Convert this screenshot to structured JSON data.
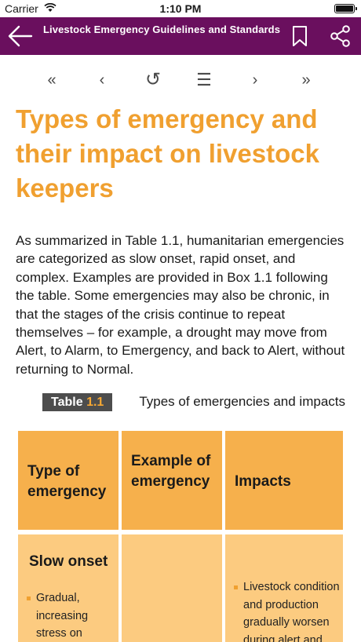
{
  "status_bar": {
    "carrier": "Carrier",
    "time": "1:10 PM"
  },
  "header": {
    "title": "Livestock Emergency Guidelines and Standards",
    "background": "#6a0f5e"
  },
  "icons": {
    "back": "arrow-left-icon",
    "bookmark": "bookmark-icon",
    "share": "share-icon"
  },
  "nav": {
    "first": "«",
    "prev": "‹",
    "reload": "↺",
    "menu": "☰",
    "next": "›",
    "last": "»"
  },
  "content": {
    "heading": "Types of emergency and their impact on livestock keepers",
    "intro": "As summarized in Table 1.1, humanitarian emergencies are categorized as slow onset, rapid onset, and complex. Examples are provided in Box 1.1 following the table. Some emergencies may also be chronic, in that the stages of the crisis continue to repeat themselves – for example, a drought may move from Alert, to Alarm, to Emergency, and back to Alert, without returning to Normal.",
    "table_caption": {
      "label": "Table",
      "number": "1.1",
      "title": "Types of emergencies and impacts"
    }
  },
  "table": {
    "headers": [
      "Type of emergency",
      "Example of emergency",
      "Impacts"
    ],
    "rows": [
      {
        "type": "Slow onset",
        "type_bullets": [
          "Gradual, increasing stress on"
        ],
        "example": "",
        "impacts_bullets": [
          "Livestock condition and production gradually worsen during alert and"
        ]
      }
    ]
  },
  "colors": {
    "accent": "#f0a030",
    "header_cell": "#f6b04c",
    "body_cell": "#fccb80",
    "label_bg": "#4d4d4d"
  }
}
